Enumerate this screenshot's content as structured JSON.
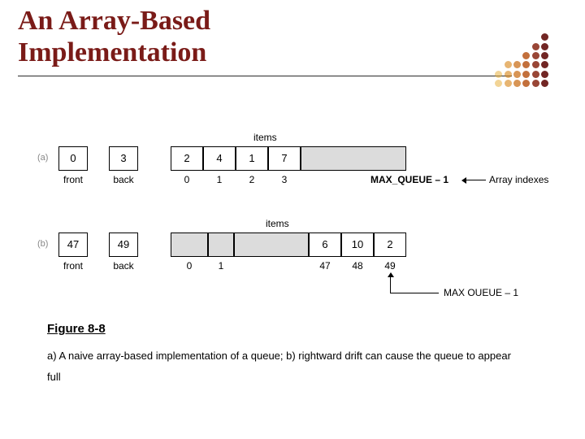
{
  "title_line1": "An Array-Based",
  "title_line2": "Implementation",
  "dot_colors": [
    "#e8b040",
    "#d98a20",
    "#c86a10",
    "#b34a08",
    "#8a2a18",
    "#6a1a18"
  ],
  "labels": {
    "items": "items",
    "front": "front",
    "back": "back",
    "max_queue": "MAX_QUEUE – 1",
    "max_oueue": "MAX OUEUE – 1",
    "array_indexes": "Array indexes"
  },
  "row_a": {
    "tag": "(a)",
    "front": "0",
    "back": "3",
    "cells": [
      "2",
      "4",
      "1",
      "7"
    ],
    "indexes": [
      "0",
      "1",
      "2",
      "3"
    ]
  },
  "row_b": {
    "tag": "(b)",
    "front": "47",
    "back": "49",
    "cells": [
      "",
      "",
      "",
      "6",
      "10",
      "2"
    ],
    "indexes": [
      "0",
      "1",
      "",
      "47",
      "48",
      "49"
    ]
  },
  "figure_number": "Figure 8-8",
  "figure_caption": "a) A naive array-based implementation of a queue; b) rightward drift can cause the queue to appear full"
}
